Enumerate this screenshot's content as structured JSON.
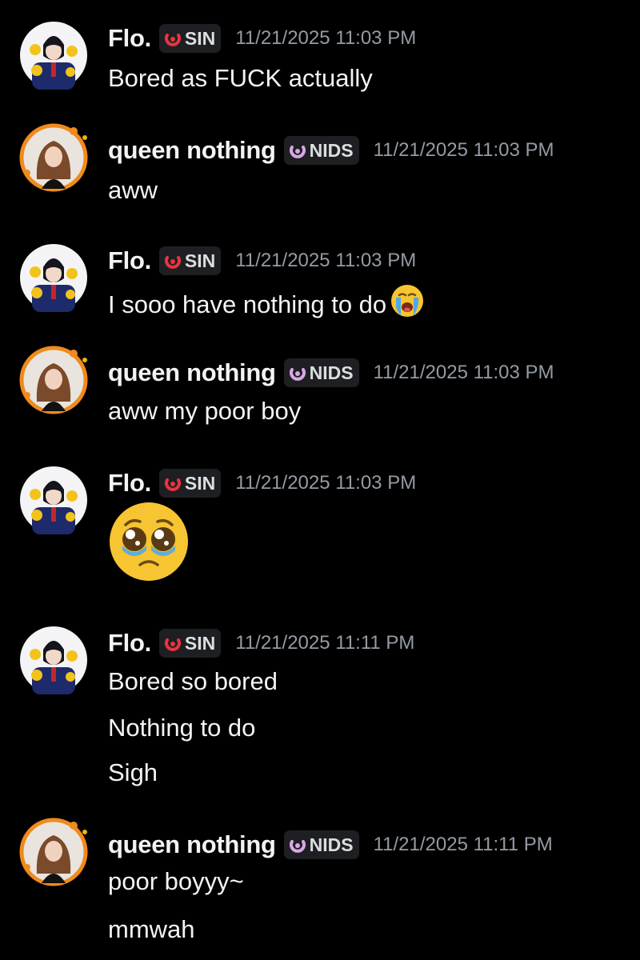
{
  "messages": [
    {
      "author": "Flo.",
      "tag": "SIN",
      "timestamp": "11/21/2025 11:03 PM",
      "lines": [
        "Bored as FUCK actually"
      ]
    },
    {
      "author": "queen nothing",
      "tag": "NIDS",
      "timestamp": "11/21/2025 11:03 PM",
      "lines": [
        "aww"
      ]
    },
    {
      "author": "Flo.",
      "tag": "SIN",
      "timestamp": "11/21/2025 11:03 PM",
      "lines": [
        "I sooo have nothing to do"
      ],
      "emoji": "loudly-crying-face"
    },
    {
      "author": "queen nothing",
      "tag": "NIDS",
      "timestamp": "11/21/2025 11:03 PM",
      "lines": [
        "aww my poor boy"
      ]
    },
    {
      "author": "Flo.",
      "tag": "SIN",
      "timestamp": "11/21/2025 11:03 PM",
      "emoji": "pleading-face"
    },
    {
      "author": "Flo.",
      "tag": "SIN",
      "timestamp": "11/21/2025 11:11 PM",
      "lines": [
        "Bored so bored",
        "Nothing to do",
        "Sigh"
      ]
    },
    {
      "author": "queen nothing",
      "tag": "NIDS",
      "timestamp": "11/21/2025 11:11 PM",
      "lines": [
        "poor boyyy~",
        "mmwah"
      ]
    }
  ],
  "colors": {
    "background": "#000000",
    "username": "#f2f3f5",
    "timestamp": "#949ba4",
    "tag_bg": "#1e1f22",
    "sin_icon": "#e8343f",
    "nids_icon": "#d9a7e6",
    "queen_avatar_ring": "#f08a1c"
  }
}
